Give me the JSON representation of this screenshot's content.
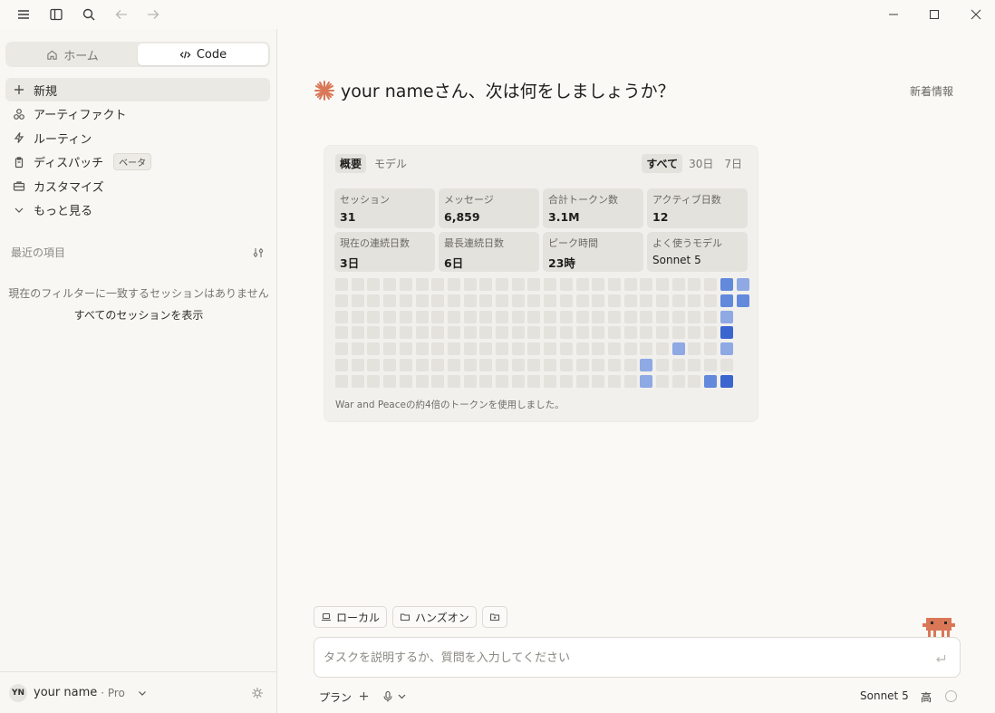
{
  "sidebar": {
    "segment": {
      "home_label": "ホーム",
      "code_label": "Code"
    },
    "nav": [
      {
        "label": "新規",
        "icon": "plus-icon"
      },
      {
        "label": "アーティファクト",
        "icon": "shapes-icon"
      },
      {
        "label": "ルーティン",
        "icon": "bolt-icon"
      },
      {
        "label": "ディスパッチ",
        "icon": "clipboard-icon",
        "badge": "ベータ"
      },
      {
        "label": "カスタマイズ",
        "icon": "briefcase-icon"
      },
      {
        "label": "もっと見る",
        "icon": "chevron-down-icon"
      }
    ],
    "recent_title": "最近の項目",
    "empty_message": "現在のフィルターに一致するセッションはありません",
    "show_all": "すべてのセッションを表示",
    "user": {
      "initials": "YN",
      "name": "your name",
      "plan": "· Pro"
    }
  },
  "main": {
    "greeting": "your nameさん、次は何をしましょうか？",
    "whats_new": "新着情報",
    "card": {
      "tabs": [
        "概要",
        "モデル"
      ],
      "ranges": [
        "すべて",
        "30日",
        "7日"
      ],
      "stats": [
        {
          "label": "セッション",
          "value": "31"
        },
        {
          "label": "メッセージ",
          "value": "6,859"
        },
        {
          "label": "合計トークン数",
          "value": "3.1M"
        },
        {
          "label": "アクティブ日数",
          "value": "12"
        },
        {
          "label": "現在の連続日数",
          "value": "3日"
        },
        {
          "label": "最長連続日数",
          "value": "6日"
        },
        {
          "label": "ピーク時間",
          "value": "23時"
        },
        {
          "label": "よく使うモデル",
          "value": "Sonnet 5"
        }
      ],
      "heatmap": {
        "columns": 26,
        "rows": 7,
        "last_column_rows": 2,
        "active": [
          {
            "col": 19,
            "row": 5,
            "level": 2
          },
          {
            "col": 19,
            "row": 6,
            "level": 2
          },
          {
            "col": 21,
            "row": 4,
            "level": 2
          },
          {
            "col": 23,
            "row": 6,
            "level": 3
          },
          {
            "col": 24,
            "row": 0,
            "level": 3
          },
          {
            "col": 24,
            "row": 1,
            "level": 3
          },
          {
            "col": 24,
            "row": 2,
            "level": 2
          },
          {
            "col": 24,
            "row": 3,
            "level": 4
          },
          {
            "col": 24,
            "row": 4,
            "level": 2
          },
          {
            "col": 24,
            "row": 6,
            "level": 4
          },
          {
            "col": 25,
            "row": 0,
            "level": 2
          },
          {
            "col": 25,
            "row": 1,
            "level": 3
          }
        ],
        "colors": [
          "#e4e2dd",
          "#b7c8ea",
          "#8ea9e3",
          "#6289db",
          "#3b66cf"
        ]
      },
      "footnote": "War and Peaceの約4倍のトークンを使用しました。"
    }
  },
  "composer": {
    "chips": [
      {
        "label": "ローカル",
        "icon": "laptop-icon"
      },
      {
        "label": "ハンズオン",
        "icon": "folder-icon"
      },
      {
        "label": "",
        "icon": "folder-plus-icon"
      }
    ],
    "placeholder": "タスクを説明するか、質問を入力してください",
    "plan_label": "プラン",
    "model": "Sonnet 5",
    "effort": "高"
  },
  "colors": {
    "accent": "#d97757",
    "heat_high": "#3b66cf"
  }
}
